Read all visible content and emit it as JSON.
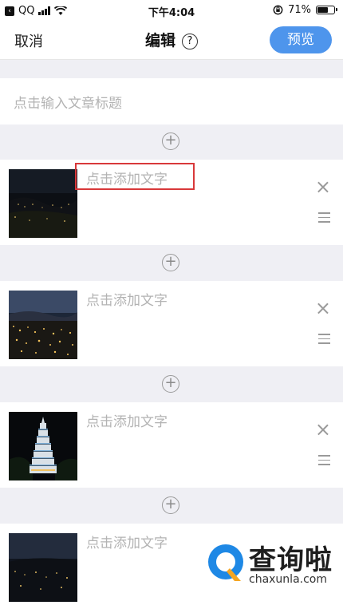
{
  "status_bar": {
    "carrier": "QQ",
    "time": "下午4:04",
    "battery": "71%",
    "battery_level": 0.71
  },
  "nav": {
    "cancel": "取消",
    "title": "编辑",
    "help": "?",
    "preview": "预览"
  },
  "title_input": {
    "placeholder": "点击输入文章标题"
  },
  "add_symbol": "+",
  "close_symbol": "×",
  "cards": [
    {
      "text": "点击添加文字",
      "image": "night-city-valley"
    },
    {
      "text": "点击添加文字",
      "image": "night-city-lights"
    },
    {
      "text": "点击添加文字",
      "image": "illuminated-pagoda"
    },
    {
      "text": "点击添加文字",
      "image": "night-cityscape"
    }
  ],
  "watermark": {
    "text": "查询啦",
    "url": "chaxunla.com"
  },
  "colors": {
    "accent": "#4e95ec",
    "highlight": "#d8383a",
    "placeholder": "#b3b3b3"
  }
}
